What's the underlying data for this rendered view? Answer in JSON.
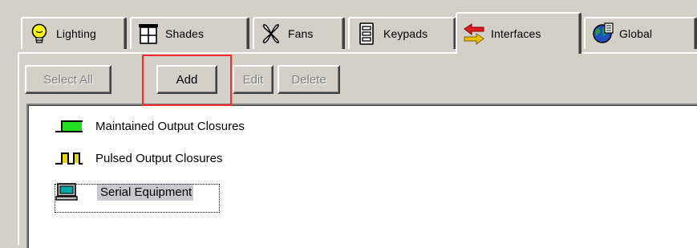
{
  "tabs": [
    {
      "label": "Lighting",
      "icon": "lightbulb-icon"
    },
    {
      "label": "Shades",
      "icon": "shades-icon"
    },
    {
      "label": "Fans",
      "icon": "fan-icon"
    },
    {
      "label": "Keypads",
      "icon": "keypad-icon"
    },
    {
      "label": "Interfaces",
      "icon": "interfaces-icon",
      "selected": true
    },
    {
      "label": "Global",
      "icon": "globe-icon"
    }
  ],
  "toolbar": {
    "select_all_label": "Select All",
    "add_label": "Add",
    "edit_label": "Edit",
    "delete_label": "Delete"
  },
  "list": {
    "items": [
      {
        "label": "Maintained Output Closures",
        "icon": "maintained-output-icon"
      },
      {
        "label": "Pulsed Output Closures",
        "icon": "pulsed-output-icon"
      },
      {
        "label": "Serial Equipment",
        "icon": "serial-equipment-icon",
        "selected": true
      }
    ]
  },
  "colors": {
    "window_bg": "#d4d0c8",
    "highlight_box": "#ff2a2a",
    "selection_bg": "#c8c8cf",
    "maintained_green": "#22dd22",
    "pulsed_yellow": "#e8d800"
  }
}
